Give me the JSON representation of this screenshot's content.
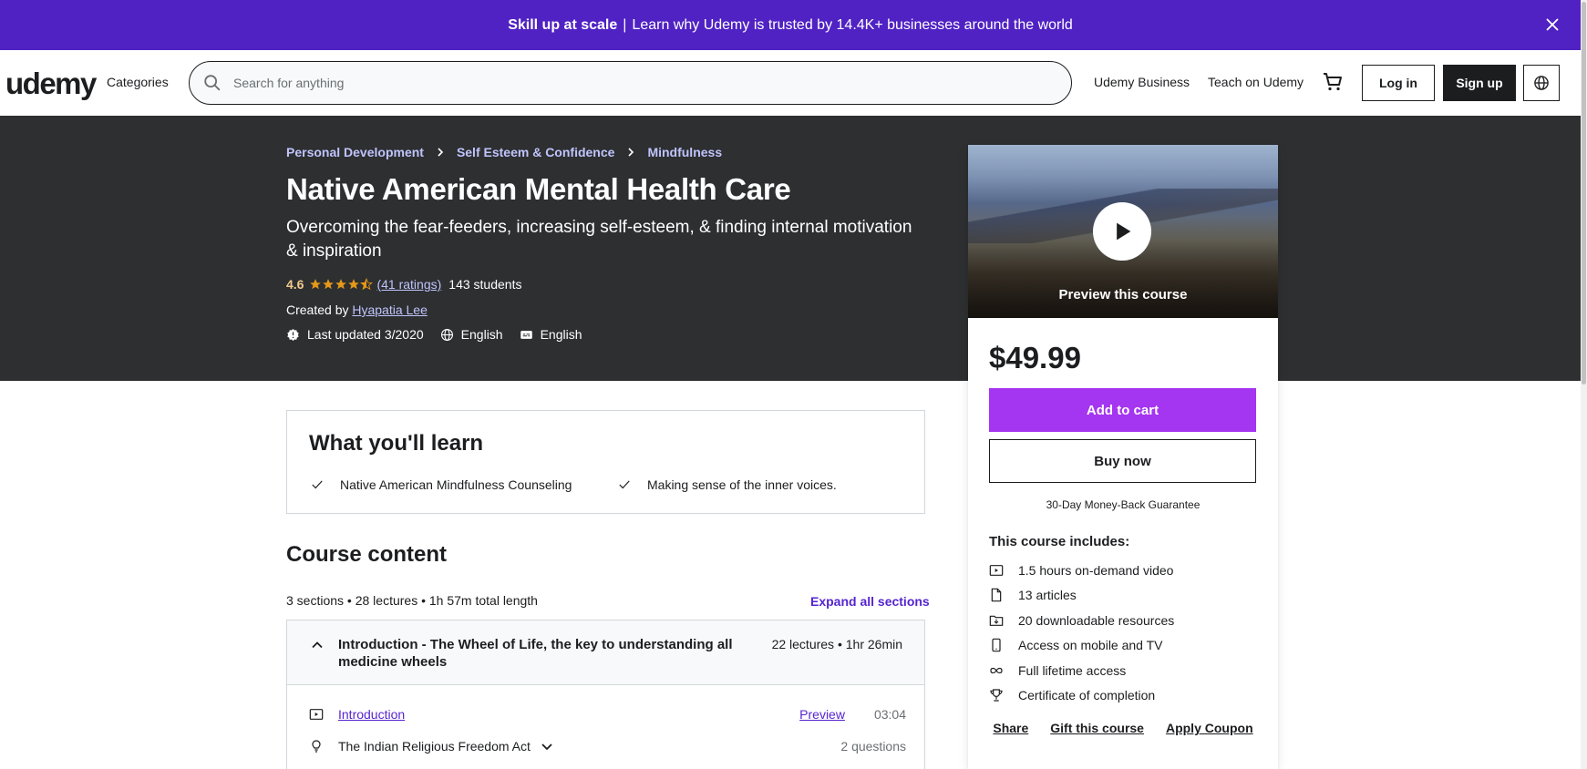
{
  "banner": {
    "bold": "Skill up at scale",
    "separator": "|",
    "text": "Learn why Udemy is trusted by 14.4K+ businesses around the world"
  },
  "header": {
    "logo": "udemy",
    "categories": "Categories",
    "search_placeholder": "Search for anything",
    "udemy_business": "Udemy Business",
    "teach": "Teach on Udemy",
    "login": "Log in",
    "signup": "Sign up"
  },
  "breadcrumb": [
    "Personal Development",
    "Self Esteem & Confidence",
    "Mindfulness"
  ],
  "course": {
    "title": "Native American Mental Health Care",
    "subtitle": "Overcoming the fear-feeders, increasing self-esteem, & finding internal motivation & inspiration",
    "rating": "4.6",
    "rating_value": 4.6,
    "ratings_count": "(41 ratings)",
    "students": "143 students",
    "created_by_label": "Created by",
    "instructor": "Hyapatia Lee",
    "last_updated": "Last updated 3/2020",
    "language": "English",
    "captions": "English"
  },
  "sidebar": {
    "preview_label": "Preview this course",
    "price": "$49.99",
    "add_to_cart": "Add to cart",
    "buy_now": "Buy now",
    "guarantee": "30-Day Money-Back Guarantee",
    "includes_title": "This course includes:",
    "includes": [
      {
        "icon": "video-icon",
        "text": "1.5 hours on-demand video"
      },
      {
        "icon": "file-icon",
        "text": "13 articles"
      },
      {
        "icon": "folder-download-icon",
        "text": "20 downloadable resources"
      },
      {
        "icon": "mobile-icon",
        "text": "Access on mobile and TV"
      },
      {
        "icon": "infinity-icon",
        "text": "Full lifetime access"
      },
      {
        "icon": "trophy-icon",
        "text": "Certificate of completion"
      }
    ],
    "links": [
      "Share",
      "Gift this course",
      "Apply Coupon"
    ]
  },
  "learn": {
    "title": "What you'll learn",
    "items": [
      "Native American Mindfulness Counseling",
      "Making sense of the inner voices."
    ]
  },
  "content": {
    "title": "Course content",
    "meta": "3 sections • 28 lectures • 1h 57m total length",
    "expand_all": "Expand all sections",
    "section": {
      "title": "Introduction - The Wheel of Life, the key to understanding all medicine wheels",
      "meta": "22 lectures • 1hr 26min"
    },
    "lectures": [
      {
        "title": "Introduction",
        "preview": "Preview",
        "duration": "03:04"
      },
      {
        "title": "The Indian Religious Freedom Act",
        "questions": "2 questions"
      }
    ]
  },
  "colors": {
    "banner": "#5022c3",
    "hero": "#2d2f31",
    "accent_purple": "#a435f0",
    "link_purple": "#5624d0",
    "star": "#e59819"
  }
}
